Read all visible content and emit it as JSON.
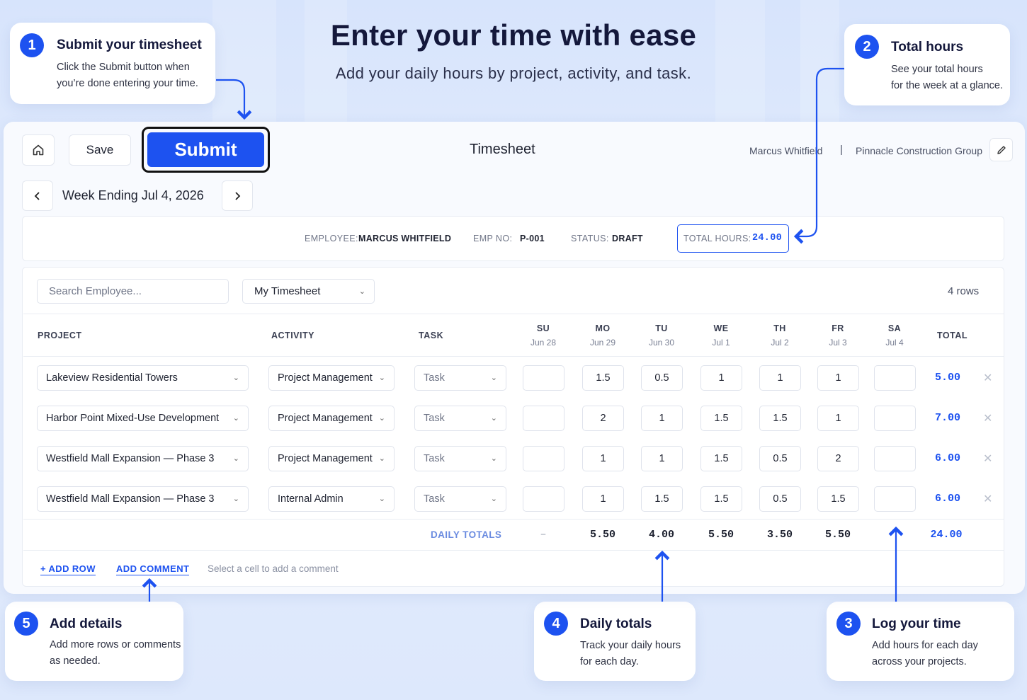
{
  "hero": {
    "title": "Enter your time with ease",
    "subtitle": "Add your daily hours by project, activity, and task."
  },
  "callouts": [
    {
      "num": "1",
      "title": "Submit your timesheet",
      "line1": "Click the Submit button when",
      "line2": "you’re done entering your time."
    },
    {
      "num": "2",
      "title": "Total hours",
      "line1": "See your total hours",
      "line2": "for the week at a glance."
    },
    {
      "num": "3",
      "title": "Log your time",
      "line1": "Add hours for each day",
      "line2": "across your projects."
    },
    {
      "num": "4",
      "title": "Daily totals",
      "line1": "Track your daily hours",
      "line2": "for each day."
    },
    {
      "num": "5",
      "title": "Add details",
      "line1": "Add more rows or comments",
      "line2": "as needed."
    }
  ],
  "toolbar": {
    "save": "Save",
    "submit": "Submit",
    "title": "Timesheet",
    "user": "Marcus Whitfield",
    "separator": "|",
    "company": "Pinnacle Construction Group"
  },
  "week": {
    "label": "Week Ending Jul 4, 2026"
  },
  "summary": {
    "employee_label": "EMPLOYEE:",
    "employee": "MARCUS WHITFIELD",
    "empno_label": "EMP NO:",
    "empno": "P-001",
    "status_label": "STATUS:",
    "status": "DRAFT",
    "total_label": "TOTAL HOURS:",
    "total": "24.00"
  },
  "filters": {
    "search_placeholder": "Search Employee...",
    "view": "My Timesheet",
    "row_count": "4 rows"
  },
  "table": {
    "headers": {
      "project": "PROJECT",
      "activity": "ACTIVITY",
      "task": "TASK",
      "total": "TOTAL"
    },
    "days": [
      {
        "day": "SU",
        "date": "Jun 28"
      },
      {
        "day": "MO",
        "date": "Jun 29"
      },
      {
        "day": "TU",
        "date": "Jun 30"
      },
      {
        "day": "WE",
        "date": "Jul 1"
      },
      {
        "day": "TH",
        "date": "Jul 2"
      },
      {
        "day": "FR",
        "date": "Jul 3"
      },
      {
        "day": "SA",
        "date": "Jul 4"
      }
    ],
    "rows": [
      {
        "project": "Lakeview Residential Towers",
        "activity": "Project Management",
        "task": "Task",
        "hours": [
          "",
          "1.5",
          "0.5",
          "1",
          "1",
          "1",
          ""
        ],
        "total": "5.00"
      },
      {
        "project": "Harbor Point Mixed-Use Development",
        "activity": "Project Management",
        "task": "Task",
        "hours": [
          "",
          "2",
          "1",
          "1.5",
          "1.5",
          "1",
          ""
        ],
        "total": "7.00"
      },
      {
        "project": "Westfield Mall Expansion — Phase 3",
        "activity": "Project Management",
        "task": "Task",
        "hours": [
          "",
          "1",
          "1",
          "1.5",
          "0.5",
          "2",
          ""
        ],
        "total": "6.00"
      },
      {
        "project": "Westfield Mall Expansion — Phase 3",
        "activity": "Internal Admin",
        "task": "Task",
        "hours": [
          "",
          "1",
          "1.5",
          "1.5",
          "0.5",
          "1.5",
          ""
        ],
        "total": "6.00"
      }
    ],
    "daily_totals_label": "DAILY TOTALS",
    "daily_totals": [
      "–",
      "5.50",
      "4.00",
      "5.50",
      "3.50",
      "5.50",
      ""
    ],
    "grand_total": "24.00"
  },
  "footer": {
    "add_row": "+ ADD ROW",
    "add_comment": "ADD COMMENT",
    "hint": "Select a cell to add a comment"
  },
  "colors": {
    "accent": "#1d52f0",
    "title": "#14183b",
    "background": "#dde8fc"
  },
  "icons": {
    "home": "home-icon",
    "prev": "chevron-left-icon",
    "next": "chevron-right-icon",
    "edit": "pencil-icon",
    "remove": "close-icon",
    "dropdown": "chevron-down-icon"
  }
}
